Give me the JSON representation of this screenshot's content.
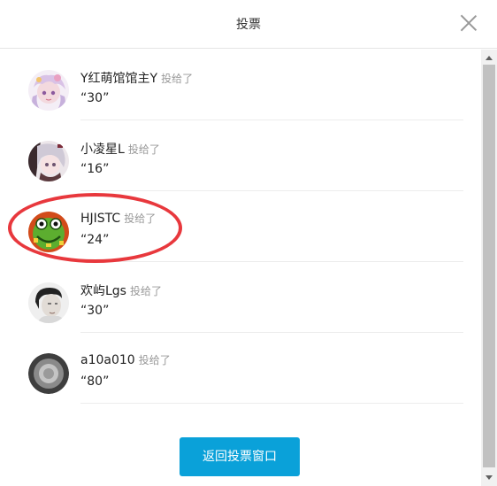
{
  "dialog": {
    "title": "投票",
    "close_icon": "close-icon"
  },
  "voters": [
    {
      "name": "Y红萌馆馆主Y",
      "action": "投给了",
      "value": "“30”",
      "avatar": "anime-girl-pink-avatar"
    },
    {
      "name": "小凌星L",
      "action": "投给了",
      "value": "“16”",
      "avatar": "anime-girl-silver-avatar"
    },
    {
      "name": "HJISTC",
      "action": "投给了",
      "value": "“24”",
      "avatar": "green-frog-avatar"
    },
    {
      "name": "欢屿Lgs",
      "action": "投给了",
      "value": "“30”",
      "avatar": "person-photo-avatar"
    },
    {
      "name": "a10a010",
      "action": "投给了",
      "value": "“80”",
      "avatar": "grey-circle-avatar"
    }
  ],
  "footer": {
    "return_label": "返回投票窗口"
  },
  "colors": {
    "accent": "#0aa1d9",
    "highlight": "#e8383d"
  }
}
